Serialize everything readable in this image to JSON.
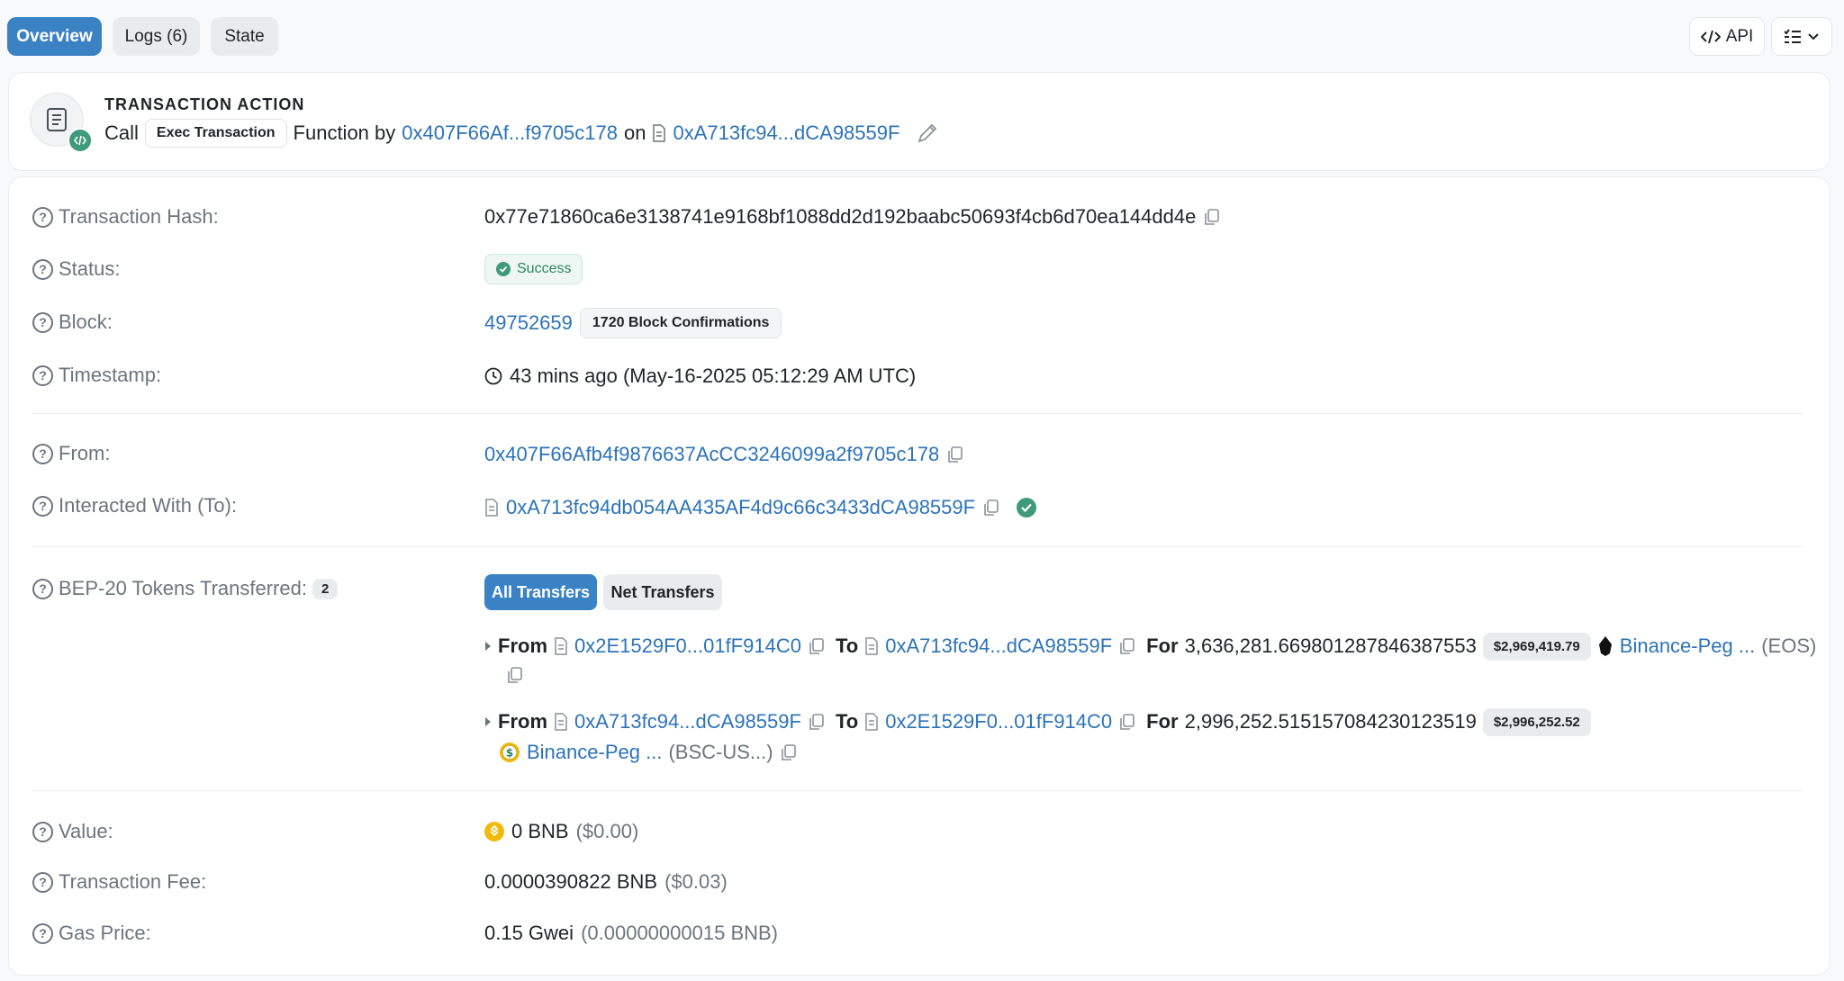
{
  "tabs": {
    "overview": "Overview",
    "logs": "Logs (6)",
    "state": "State"
  },
  "toolbar": {
    "api_label": "API"
  },
  "action": {
    "title": "TRANSACTION ACTION",
    "call": "Call",
    "method": "Exec Transaction",
    "function_by": "Function by",
    "caller": "0x407F66Af...f9705c178",
    "on": "on",
    "contract": "0xA713fc94...dCA98559F"
  },
  "details": {
    "hash": {
      "label": "Transaction Hash:",
      "value": "0x77e71860ca6e3138741e9168bf1088dd2d192baabc50693f4cb6d70ea144dd4e"
    },
    "status": {
      "label": "Status:",
      "value": "Success"
    },
    "block": {
      "label": "Block:",
      "value": "49752659",
      "confirmations": "1720 Block Confirmations"
    },
    "timestamp": {
      "label": "Timestamp:",
      "value": "43 mins ago (May-16-2025 05:12:29 AM UTC)"
    },
    "from": {
      "label": "From:",
      "value": "0x407F66Afb4f9876637AcCC3246099a2f9705c178"
    },
    "to": {
      "label": "Interacted With (To):",
      "value": "0xA713fc94db054AA435AF4d9c66c3433dCA98559F"
    },
    "tokens": {
      "label": "BEP-20 Tokens Transferred:",
      "count": "2",
      "all_label": "All Transfers",
      "net_label": "Net Transfers",
      "transfers": [
        {
          "from_label": "From",
          "from": "0x2E1529F0...01fF914C0",
          "to_label": "To",
          "to": "0xA713fc94...dCA98559F",
          "for_label": "For",
          "amount": "3,636,281.669801287846387553",
          "usd": "$2,969,419.79",
          "token": "Binance-Peg ...",
          "symbol": "(EOS)"
        },
        {
          "from_label": "From",
          "from": "0xA713fc94...dCA98559F",
          "to_label": "To",
          "to": "0x2E1529F0...01fF914C0",
          "for_label": "For",
          "amount": "2,996,252.515157084230123519",
          "usd": "$2,996,252.52",
          "token": "Binance-Peg ...",
          "symbol": "(BSC-US...)"
        }
      ]
    },
    "value": {
      "label": "Value:",
      "amount": "0 BNB",
      "usd": "($0.00)"
    },
    "fee": {
      "label": "Transaction Fee:",
      "amount": "0.0000390822 BNB",
      "usd": "($0.03)"
    },
    "gas": {
      "label": "Gas Price:",
      "amount": "0.15 Gwei",
      "detail": "(0.00000000015 BNB)"
    }
  },
  "colors": {
    "accent": "#3b82c4",
    "link": "#2c73b8",
    "success": "#3f9a7b"
  },
  "icons": [
    "question-circle-icon",
    "copy-icon",
    "document-icon",
    "clock-icon",
    "check-circle-icon",
    "pencil-icon",
    "code-icon",
    "list-icon",
    "chevron-down-icon",
    "caret-right-icon",
    "eos-token-icon",
    "bsc-usd-token-icon",
    "bnb-icon"
  ]
}
